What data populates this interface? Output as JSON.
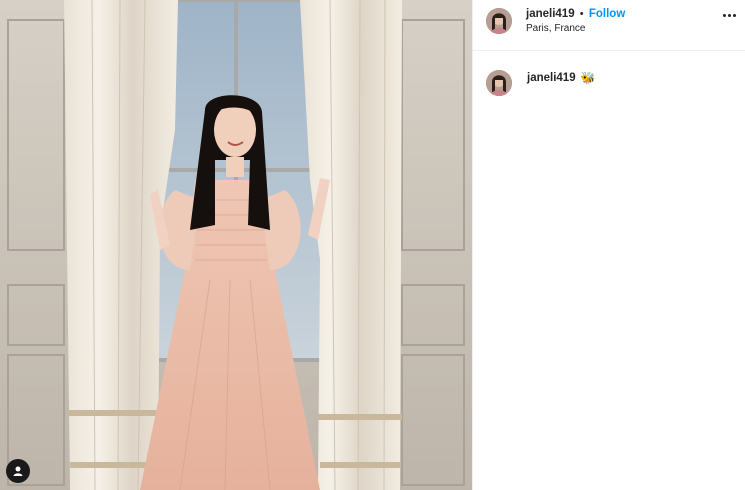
{
  "post": {
    "username": "janeli419",
    "separator": "•",
    "follow_label": "Follow",
    "location": "Paris, France",
    "more_icon": "more-horizontal-icon",
    "photo_alt": "woman in pink dress between curtains",
    "tag_icon": "user-tag-icon"
  },
  "caption": {
    "username": "janeli419",
    "emoji": "🐝"
  },
  "colors": {
    "follow_blue": "#0095f6",
    "text": "#262626",
    "divider": "#efefef"
  }
}
